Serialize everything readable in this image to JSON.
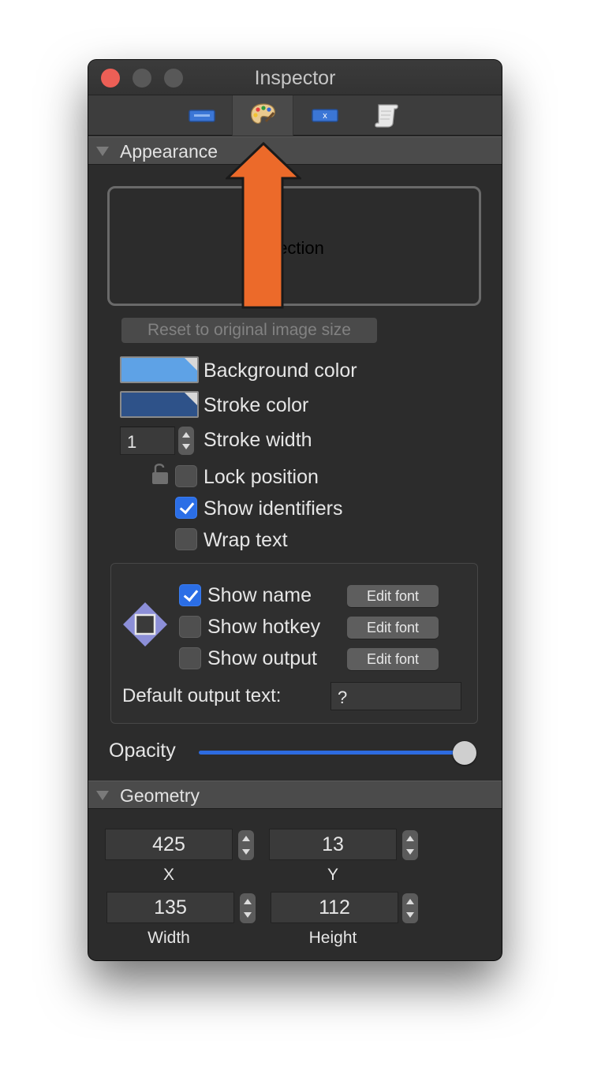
{
  "window": {
    "title": "Inspector"
  },
  "toolbar": {
    "tabs": [
      {
        "name": "identifier-tab",
        "active": false
      },
      {
        "name": "appearance-tab",
        "active": true
      },
      {
        "name": "variable-tab",
        "active": false
      },
      {
        "name": "note-tab",
        "active": false
      }
    ],
    "variable_glyph": "x"
  },
  "appearance": {
    "header": "Appearance",
    "preview_text": "election",
    "reset_button": "Reset to original image size",
    "background_color_label": "Background color",
    "background_color": "#5ea2e6",
    "stroke_color_label": "Stroke color",
    "stroke_color": "#2e5289",
    "stroke_width_label": "Stroke width",
    "stroke_width_value": "1",
    "lock_position_label": "Lock position",
    "lock_position_checked": false,
    "show_identifiers_label": "Show identifiers",
    "show_identifiers_checked": true,
    "wrap_text_label": "Wrap text",
    "wrap_text_checked": false,
    "show_name_label": "Show name",
    "show_name_checked": true,
    "show_hotkey_label": "Show hotkey",
    "show_hotkey_checked": false,
    "show_output_label": "Show output",
    "show_output_checked": false,
    "edit_font_label": "Edit font",
    "default_output_label": "Default output text:",
    "default_output_value": "?",
    "opacity_label": "Opacity",
    "opacity_value": 1.0
  },
  "geometry": {
    "header": "Geometry",
    "x_value": "425",
    "x_label": "X",
    "y_value": "13",
    "y_label": "Y",
    "width_value": "135",
    "width_label": "Width",
    "height_value": "112",
    "height_label": "Height"
  },
  "colors": {
    "close_light": "#ec5f56",
    "accent": "#2b6ee6",
    "annotation_arrow": "#ec6a2a"
  }
}
